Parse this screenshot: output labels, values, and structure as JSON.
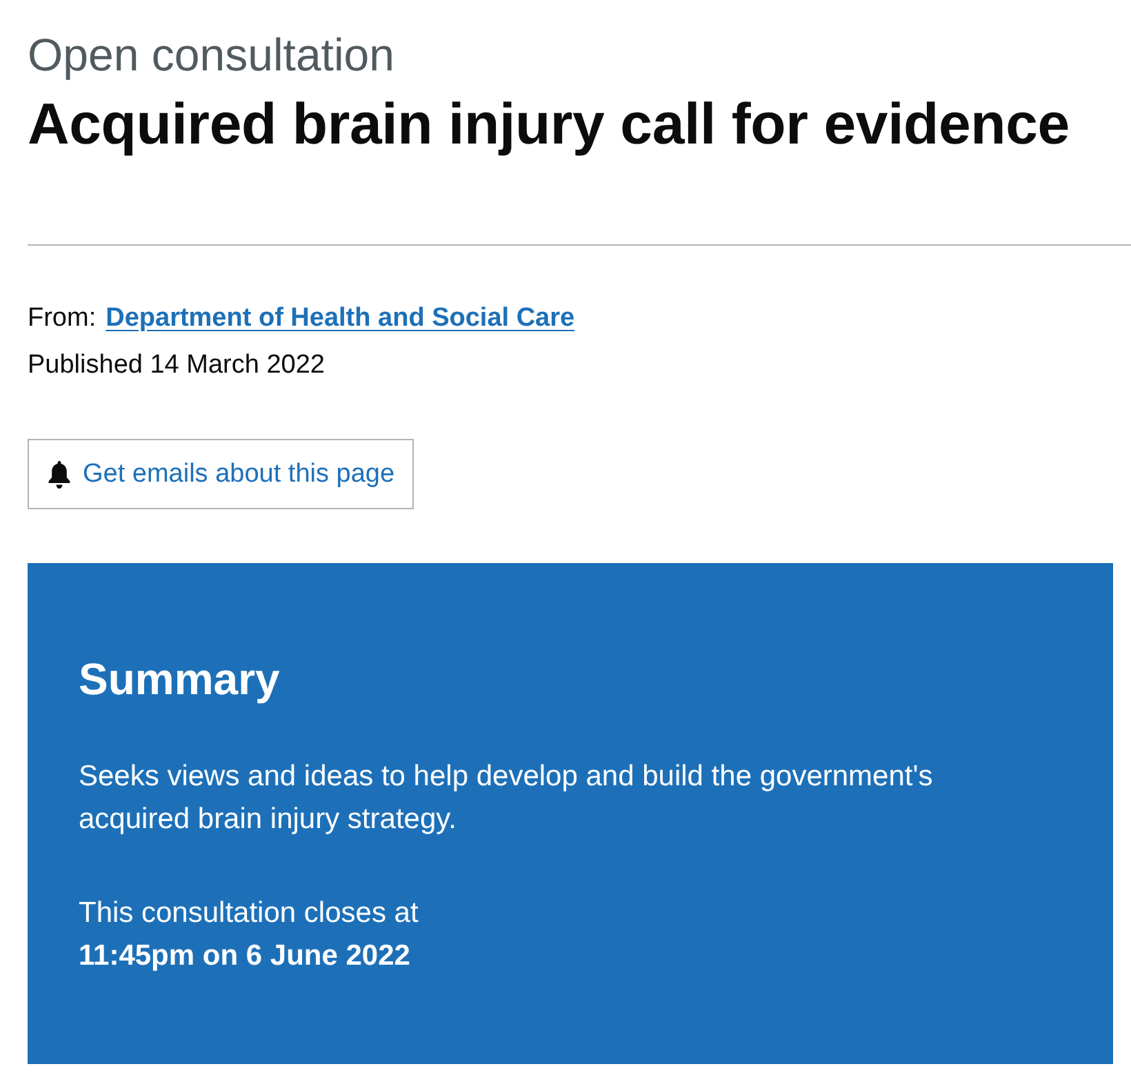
{
  "header": {
    "context": "Open consultation",
    "title": "Acquired brain injury call for evidence"
  },
  "metadata": {
    "from_label": "From:",
    "organisation": "Department of Health and Social Care",
    "published": "Published 14 March 2022"
  },
  "email_signup": {
    "label": "Get emails about this page"
  },
  "summary": {
    "title": "Summary",
    "description": "Seeks views and ideas to help develop and build the government's acquired brain injury strategy.",
    "closing": "This consultation closes at **11:45pm on 6 June 2022**"
  }
}
